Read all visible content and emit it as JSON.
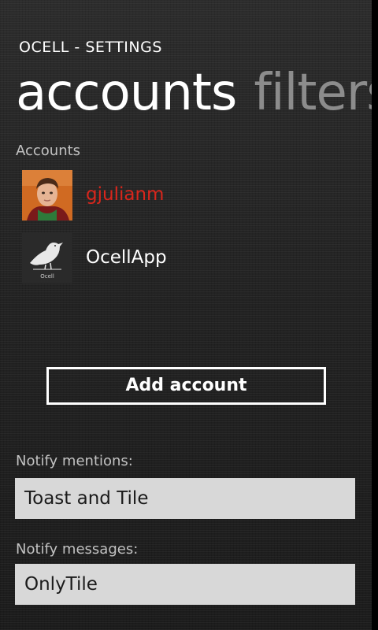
{
  "app_title": "OCELL - SETTINGS",
  "pivot": {
    "items": [
      {
        "label": "accounts",
        "active": true
      },
      {
        "label": "filters",
        "active": false
      }
    ]
  },
  "accounts_section": {
    "label": "Accounts",
    "items": [
      {
        "name": "gjulianm",
        "icon": "user-photo-avatar",
        "color": "#d9261c"
      },
      {
        "name": "OcellApp",
        "icon": "ocell-bird-logo",
        "logo_text": "Ocell",
        "color": "#ffffff"
      }
    ]
  },
  "add_account_button": "Add account",
  "notify_mentions": {
    "label": "Notify mentions:",
    "value": "Toast and Tile"
  },
  "notify_messages": {
    "label": "Notify messages:",
    "value": "OnlyTile"
  }
}
